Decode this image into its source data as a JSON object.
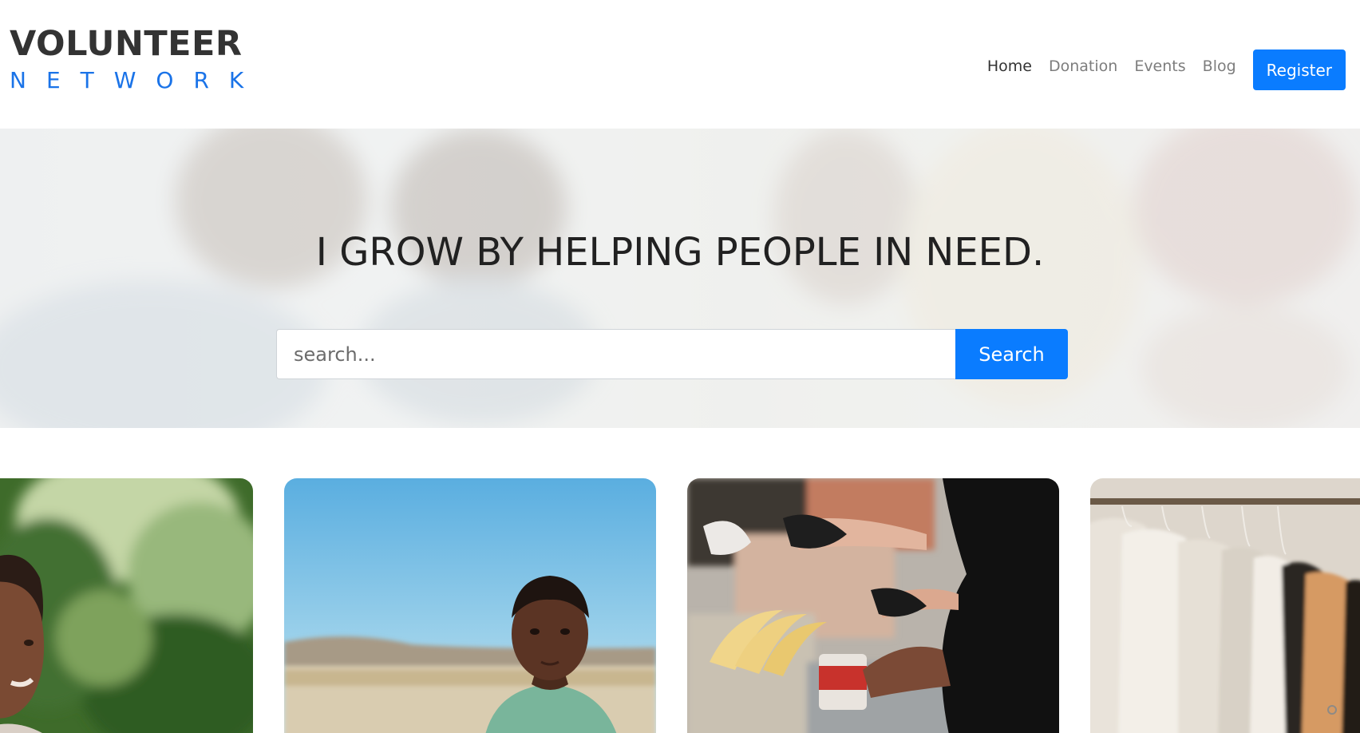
{
  "logo": {
    "line1": "VOLUNTEER",
    "line2": "NETWORK"
  },
  "nav": {
    "items": [
      {
        "label": "Home",
        "active": true
      },
      {
        "label": "Donation",
        "active": false
      },
      {
        "label": "Events",
        "active": false
      },
      {
        "label": "Blog",
        "active": false
      }
    ],
    "register_label": "Register"
  },
  "hero": {
    "title": "I GROW BY HELPING PEOPLE IN NEED.",
    "search_placeholder": "search...",
    "search_button": "Search"
  },
  "colors": {
    "accent": "#0a7cff",
    "logo_dark": "#333333",
    "logo_blue": "#1a73e8"
  },
  "cards": [
    {
      "image": "smiling-girl-photo"
    },
    {
      "image": "boy-field-photo"
    },
    {
      "image": "food-drive-photo"
    },
    {
      "image": "clothing-rack-photo"
    }
  ]
}
